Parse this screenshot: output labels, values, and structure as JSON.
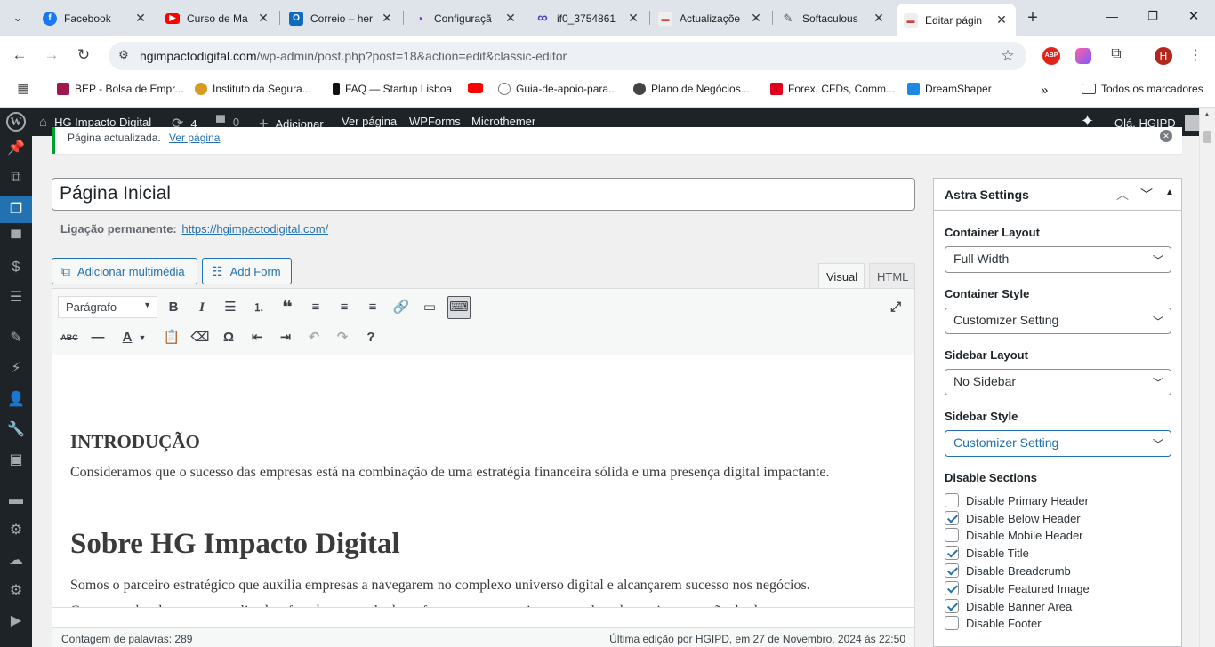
{
  "browser": {
    "tabs": [
      {
        "title": "Facebook",
        "icon": "facebook-icon",
        "color": "#1877f2"
      },
      {
        "title": "Curso de Ma",
        "icon": "youtube-icon",
        "color": "#ff0000"
      },
      {
        "title": "Correio – her",
        "icon": "outlook-icon",
        "color": "#0f6cbd"
      },
      {
        "title": "Configuraçã",
        "icon": "configuration-icon",
        "color": "#8a2be2"
      },
      {
        "title": "if0_3754861",
        "icon": "infinity-icon",
        "color": "#4b3cc9"
      },
      {
        "title": "Actualizaçõe",
        "icon": "wp-icon",
        "color": "#c44"
      },
      {
        "title": "Softaculous",
        "icon": "softaculous-icon",
        "color": "#555"
      },
      {
        "title": "Editar págin",
        "icon": "wp-icon",
        "color": "#c44"
      }
    ],
    "url_host": "hgimpactodigital.com",
    "url_path": "/wp-admin/post.php?post=18&action=edit&classic-editor",
    "profile_letter": "H",
    "bookmarks": [
      {
        "label": "BEP - Bolsa de Empr...",
        "color": "#a01850"
      },
      {
        "label": "Instituto da Segura...",
        "color": "#d89a20"
      },
      {
        "label": "FAQ — Startup Lisboa",
        "color": "#111"
      },
      {
        "label": "",
        "color": "#ff0000"
      },
      {
        "label": "Guia-de-apoio-para...",
        "color": "#777"
      },
      {
        "label": "Plano de Negócios...",
        "color": "#333"
      },
      {
        "label": "Forex, CFDs, Comm...",
        "color": "#e0001b"
      },
      {
        "label": "DreamShaper",
        "color": "#1e88e5"
      }
    ],
    "all_bookmarks": "Todos os marcadores",
    "overflow": "»"
  },
  "adminbar": {
    "site_name": "HG Impacto Digital",
    "updates": "4",
    "comments": "0",
    "add": "Adicionar",
    "view_page": "Ver página",
    "wpforms": "WPForms",
    "microthemer": "Microthemer",
    "greeting": "Olá, HGIPD"
  },
  "notice": {
    "text": "Página actualizada.",
    "link": "Ver página"
  },
  "post": {
    "title": "Página Inicial",
    "permalink_label": "Ligação permanente:",
    "permalink": "https://hgimpactodigital.com/"
  },
  "editor": {
    "add_media": "Adicionar multimédia",
    "add_form": "Add Form",
    "tab_visual": "Visual",
    "tab_html": "HTML",
    "format": "Parágrafo",
    "h_intro": "INTRODUÇÃO",
    "p_intro": "Consideramos que o sucesso das empresas está na combinação de uma estratégia financeira sólida e uma presença digital impactante.",
    "h_about": "Sobre HG Impacto Digital",
    "p_about": "Somos o parceiro estratégico que auxilia empresas a navegarem no complexo universo digital e alcançarem sucesso nos negócios.",
    "p_about2": "Com uma abordagem personalizada e focada em resultados, oferecemos um conjunto completo de serviços que vão desde",
    "word_count": "Contagem de palavras: 289",
    "last_edit": "Última edição por HGIPD, em 27 de Novembro, 2024 às 22:50"
  },
  "astra": {
    "title": "Astra Settings",
    "container_layout_label": "Container Layout",
    "container_layout": "Full Width",
    "container_style_label": "Container Style",
    "container_style": "Customizer Setting",
    "sidebar_layout_label": "Sidebar Layout",
    "sidebar_layout": "No Sidebar",
    "sidebar_style_label": "Sidebar Style",
    "sidebar_style": "Customizer Setting",
    "disable_label": "Disable Sections",
    "options": [
      {
        "label": "Disable Primary Header",
        "checked": false
      },
      {
        "label": "Disable Below Header",
        "checked": true
      },
      {
        "label": "Disable Mobile Header",
        "checked": false
      },
      {
        "label": "Disable Title",
        "checked": true
      },
      {
        "label": "Disable Breadcrumb",
        "checked": true
      },
      {
        "label": "Disable Featured Image",
        "checked": true
      },
      {
        "label": "Disable Banner Area",
        "checked": true
      },
      {
        "label": "Disable Footer",
        "checked": false
      }
    ]
  }
}
